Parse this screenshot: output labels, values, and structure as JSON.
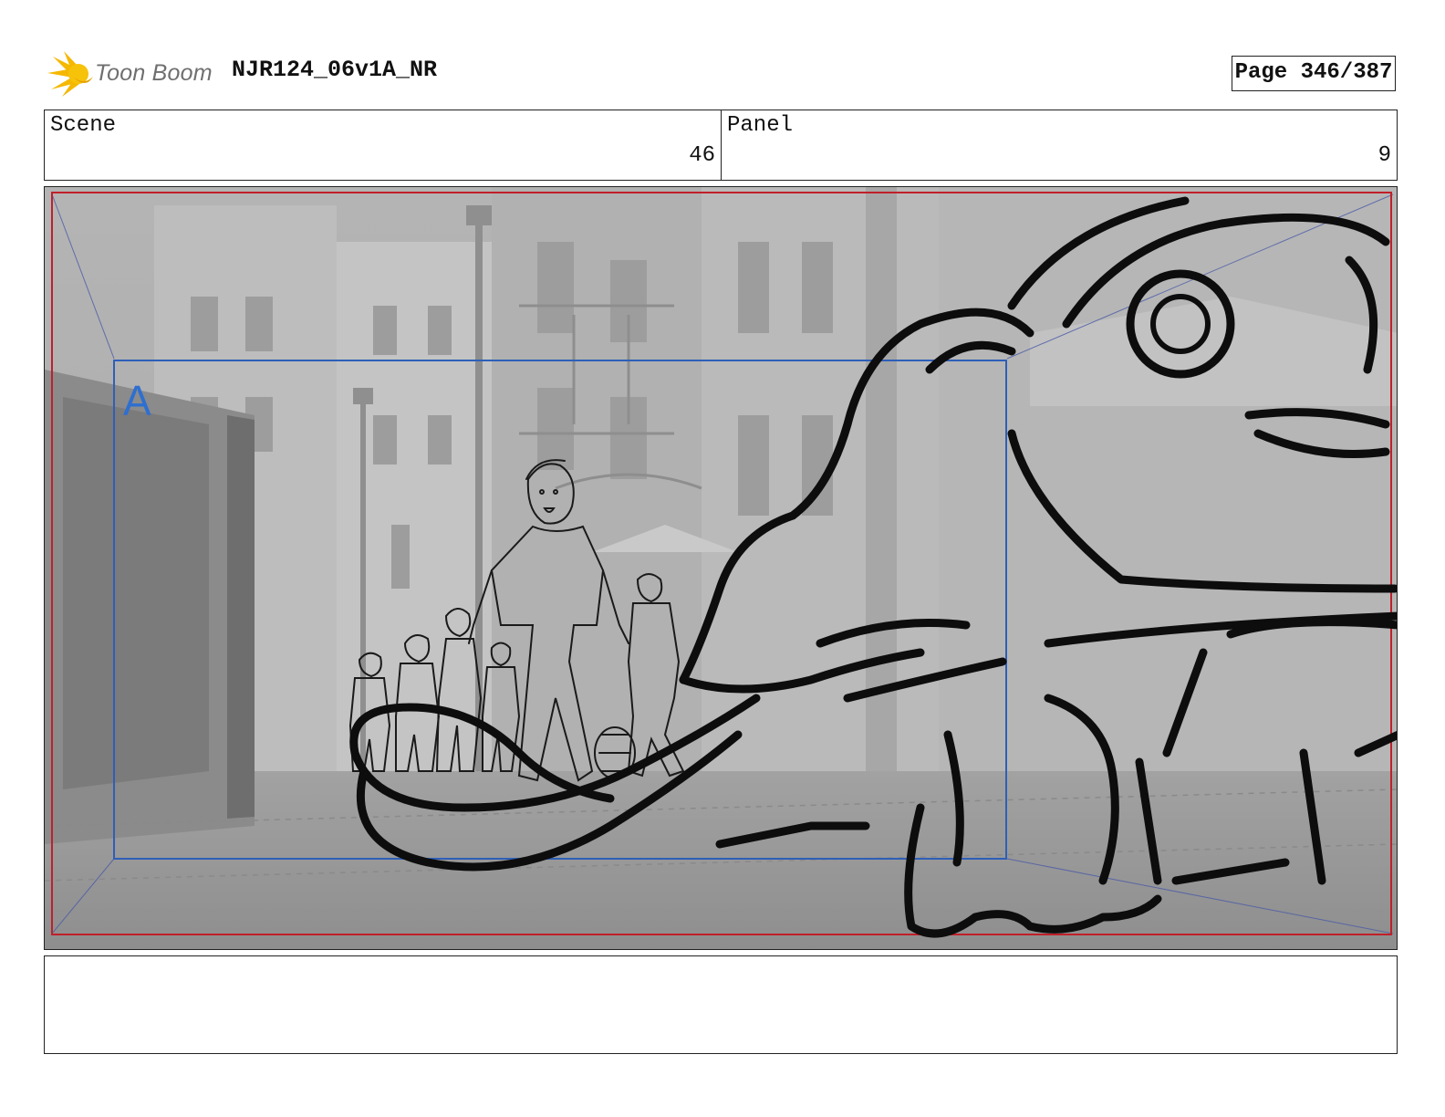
{
  "header": {
    "logo_text": "Toon Boom",
    "document_title": "NJR124_06v1A_NR",
    "page_label": "Page 346/387"
  },
  "info": {
    "scene_label": "Scene",
    "scene_value": "46",
    "panel_label": "Panel",
    "panel_value": "9"
  },
  "panel_image": {
    "camera_label": "A"
  },
  "notes": {
    "text": ""
  },
  "colors": {
    "safe_frame": "#c0202a",
    "camera_frame": "#2e5fb8",
    "logo_yellow": "#f5b800"
  }
}
